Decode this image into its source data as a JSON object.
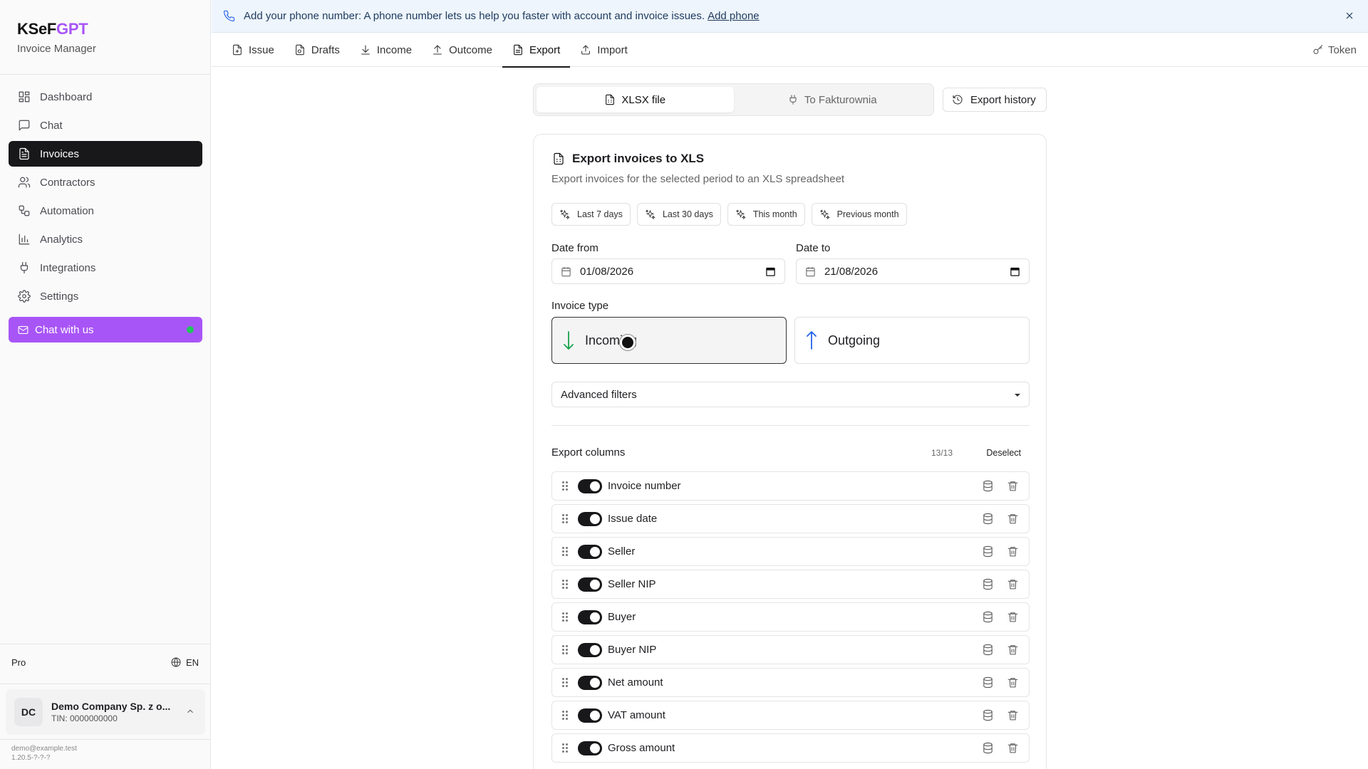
{
  "brand": {
    "name_part1": "KSeF",
    "name_part2": "GPT",
    "subtitle": "Invoice Manager",
    "accent": "#a855f7"
  },
  "sidebar": {
    "items": [
      {
        "label": "Dashboard",
        "icon": "dashboard-icon"
      },
      {
        "label": "Chat",
        "icon": "chat-icon"
      },
      {
        "label": "Invoices",
        "icon": "invoice-icon",
        "active": true
      },
      {
        "label": "Contractors",
        "icon": "users-icon"
      },
      {
        "label": "Automation",
        "icon": "workflow-icon"
      },
      {
        "label": "Analytics",
        "icon": "bar-chart-icon"
      },
      {
        "label": "Integrations",
        "icon": "plug-icon"
      },
      {
        "label": "Settings",
        "icon": "gear-icon"
      }
    ],
    "chat_with_us": "Chat with us",
    "plan": "Pro",
    "language": "EN",
    "company": {
      "initials": "DC",
      "name": "Demo Company Sp. z o...",
      "tin": "TIN: 0000000000"
    },
    "email": "demo@example.test",
    "version": "1.20.5-?-?-?"
  },
  "banner": {
    "text": "Add your phone number: A phone number lets us help you faster with account and invoice issues.",
    "link": "Add phone"
  },
  "tabs": [
    {
      "label": "Issue",
      "icon": "file-plus-icon"
    },
    {
      "label": "Drafts",
      "icon": "draft-icon"
    },
    {
      "label": "Income",
      "icon": "download-icon"
    },
    {
      "label": "Outcome",
      "icon": "upload-icon"
    },
    {
      "label": "Export",
      "icon": "file-text-icon",
      "active": true
    },
    {
      "label": "Import",
      "icon": "import-icon"
    }
  ],
  "token_label": "Token",
  "export_mode": {
    "xlsx": "XLSX file",
    "fakturownia": "To Fakturownia",
    "history": "Export history"
  },
  "card": {
    "title": "Export invoices to XLS",
    "description": "Export invoices for the selected period to an XLS spreadsheet",
    "quick_ranges": [
      "Last 7 days",
      "Last 30 days",
      "This month",
      "Previous month"
    ],
    "date_from_label": "Date from",
    "date_from": "01/08/2026",
    "date_to_label": "Date to",
    "date_to": "21/08/2026",
    "invoice_type_label": "Invoice type",
    "incoming": "Incoming",
    "outgoing": "Outgoing",
    "incoming_color": "#16a34a",
    "outgoing_color": "#2563eb",
    "advanced_filters": "Advanced filters",
    "columns_label": "Export columns",
    "columns_count": "13/13",
    "deselect": "Deselect",
    "columns": [
      "Invoice number",
      "Issue date",
      "Seller",
      "Seller NIP",
      "Buyer",
      "Buyer NIP",
      "Net amount",
      "VAT amount",
      "Gross amount"
    ]
  }
}
